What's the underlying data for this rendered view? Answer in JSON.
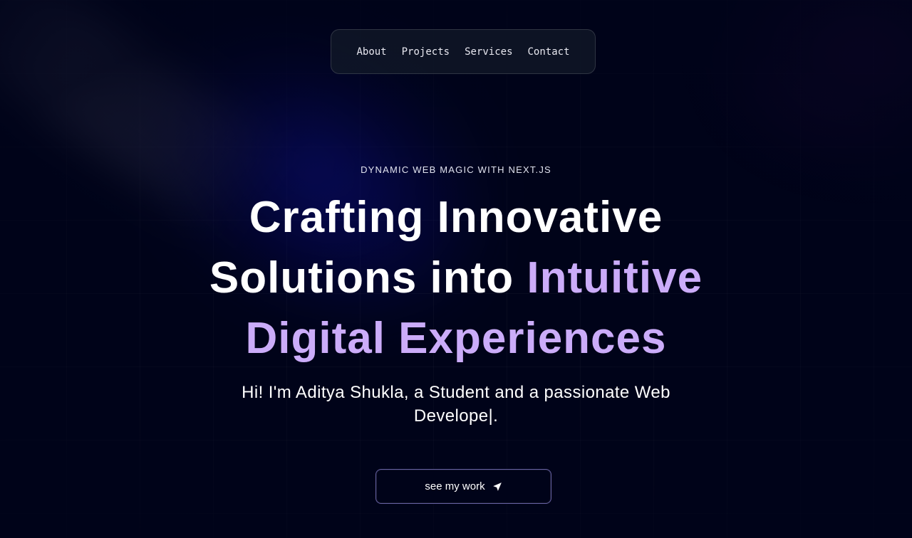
{
  "nav": {
    "items": [
      {
        "label": "About"
      },
      {
        "label": "Projects"
      },
      {
        "label": "Services"
      },
      {
        "label": "Contact"
      }
    ]
  },
  "hero": {
    "eyebrow": "DYNAMIC WEB MAGIC WITH NEXT.JS",
    "headline": {
      "line1": "Crafting Innovative",
      "line2_plain": "Solutions into",
      "line2_accent": "Intuitive",
      "line3_accent": "Digital Experiences"
    },
    "subtitle": {
      "line1": "Hi! I'm Aditya Shukla, a Student and a passionate Web",
      "line2": "Develope|."
    },
    "cta": {
      "label": "see my work",
      "icon": "send-icon"
    }
  },
  "colors": {
    "background": "#000319",
    "accent": "#cbacf9",
    "text": "#ffffff"
  }
}
